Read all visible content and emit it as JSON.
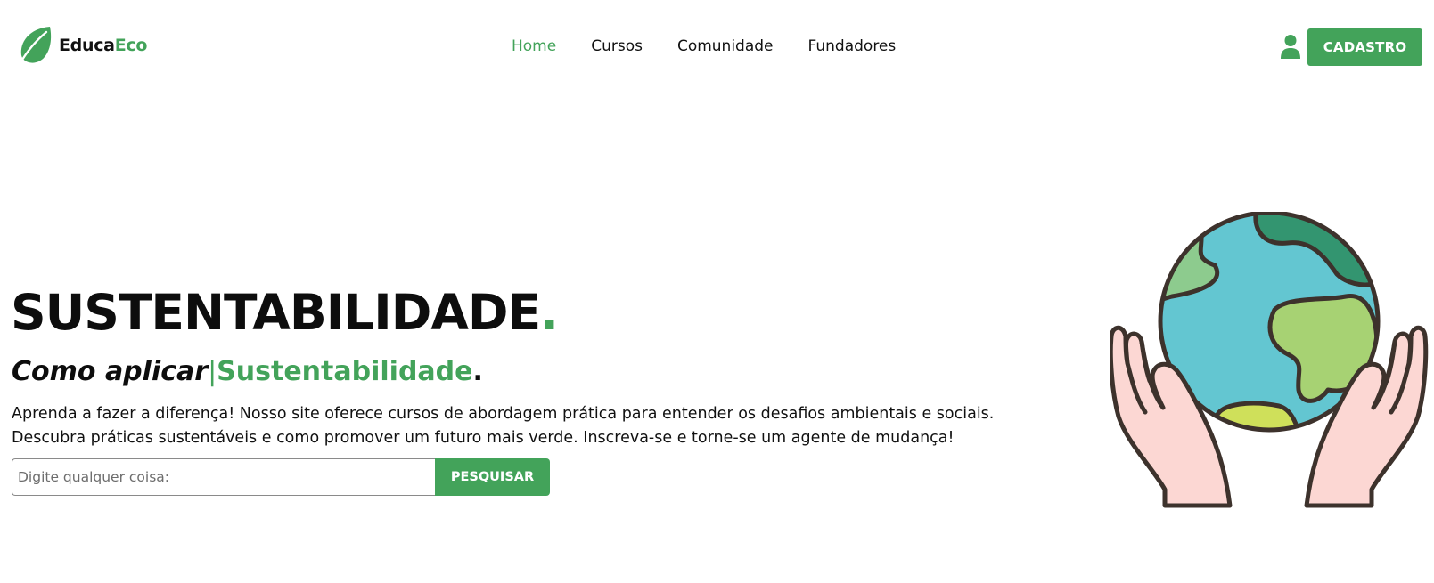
{
  "brand": {
    "name_part1": "Educa",
    "name_part2": "Eco",
    "logo_icon": "leaf-icon",
    "accent_color": "#43a35a"
  },
  "nav": {
    "items": [
      {
        "label": "Home",
        "active": true
      },
      {
        "label": "Cursos",
        "active": false
      },
      {
        "label": "Comunidade",
        "active": false
      },
      {
        "label": "Fundadores",
        "active": false
      }
    ]
  },
  "header_actions": {
    "user_icon": "user-icon",
    "signup_label": "CADASTRO"
  },
  "hero": {
    "title": "SUSTENTABILIDADE",
    "title_dot": ".",
    "subtitle_lead": "Como aplicar",
    "subtitle_cursor": "|",
    "subtitle_highlight": "Sustentabilidade",
    "subtitle_end": ".",
    "description_line1": "Aprenda a fazer a diferença! Nosso site oferece cursos de abordagem prática para entender os desafios ambientais e sociais.",
    "description_line2": "Descubra práticas sustentáveis e como promover um futuro mais verde. Inscreva-se e torne-se um agente de mudança!",
    "illustration": "hands-holding-globe"
  },
  "search": {
    "placeholder": "Digite qualquer coisa:",
    "value": "",
    "button_label": "PESQUISAR"
  }
}
